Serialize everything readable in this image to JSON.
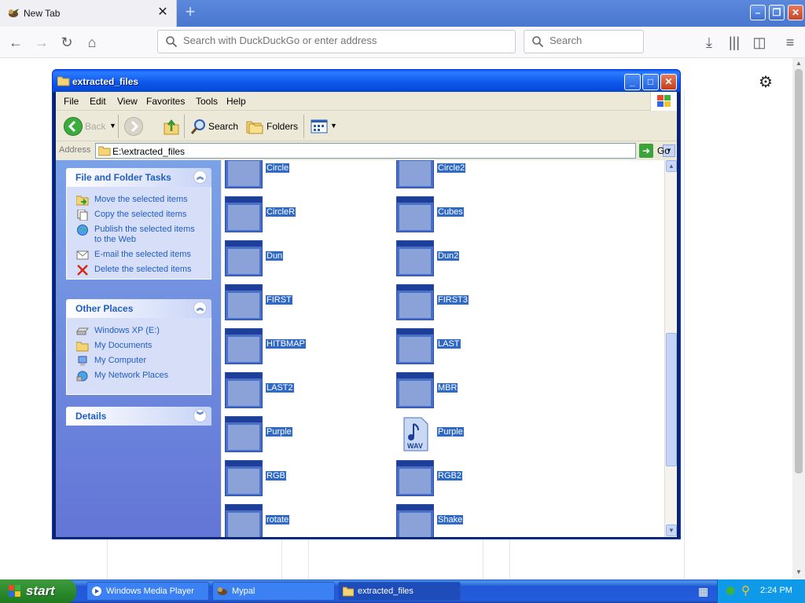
{
  "firefox": {
    "tab_title": "New Tab",
    "url_placeholder": "Search with DuckDuckGo or enter address",
    "search_placeholder": "Search"
  },
  "explorer": {
    "window_title": "extracted_files",
    "menu": [
      "File",
      "Edit",
      "View",
      "Favorites",
      "Tools",
      "Help"
    ],
    "toolbar": {
      "back": "Back",
      "search": "Search",
      "folders": "Folders"
    },
    "address": {
      "label": "Address",
      "value": "E:\\extracted_files",
      "go": "Go"
    },
    "tasks": {
      "file_folder": {
        "title": "File and Folder Tasks",
        "items": [
          "Move the selected items",
          "Copy the selected items",
          "Publish the selected items to the Web",
          "E-mail the selected items",
          "Delete the selected items"
        ]
      },
      "other_places": {
        "title": "Other Places",
        "items": [
          "Windows XP (E:)",
          "My Documents",
          "My Computer",
          "My Network Places"
        ]
      },
      "details": {
        "title": "Details"
      }
    },
    "files": [
      {
        "name": "Circle",
        "type": "app"
      },
      {
        "name": "Circle2",
        "type": "app"
      },
      {
        "name": "CircleR",
        "type": "app"
      },
      {
        "name": "Cubes",
        "type": "app"
      },
      {
        "name": "Dun",
        "type": "app"
      },
      {
        "name": "Dun2",
        "type": "app"
      },
      {
        "name": "FIRST",
        "type": "app"
      },
      {
        "name": "FIRST3",
        "type": "app"
      },
      {
        "name": "HITBMAP",
        "type": "app"
      },
      {
        "name": "LAST",
        "type": "app"
      },
      {
        "name": "LAST2",
        "type": "app"
      },
      {
        "name": "MBR",
        "type": "app"
      },
      {
        "name": "Purple",
        "type": "app"
      },
      {
        "name": "Purple",
        "type": "wav"
      },
      {
        "name": "RGB",
        "type": "app"
      },
      {
        "name": "RGB2",
        "type": "app"
      },
      {
        "name": "rotate",
        "type": "app"
      },
      {
        "name": "Shake",
        "type": "app"
      }
    ]
  },
  "taskbar": {
    "start": "start",
    "buttons": [
      "Windows Media Player",
      "Mypal",
      "extracted_files"
    ],
    "clock": "2:24 PM"
  },
  "icons": {
    "wav_label": "WAV"
  }
}
